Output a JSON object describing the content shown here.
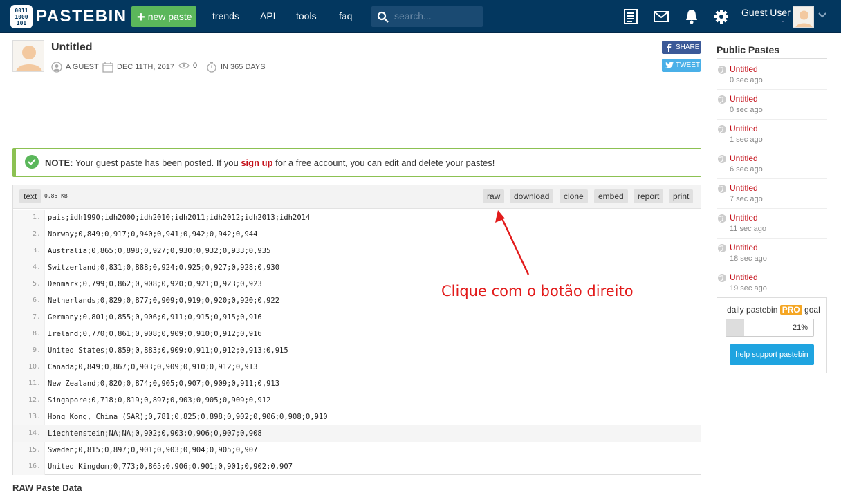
{
  "header": {
    "brand": "PASTEBIN",
    "new_paste": "new paste",
    "nav": [
      "trends",
      "API",
      "tools",
      "faq"
    ],
    "search_placeholder": "search...",
    "user_name": "Guest User",
    "user_sub": "-"
  },
  "paste": {
    "title": "Untitled",
    "author": "A GUEST",
    "date": "DEC 11TH, 2017",
    "views": "0",
    "expires": "IN 365 DAYS",
    "share": "SHARE",
    "tweet": "TWEET"
  },
  "note": {
    "label": "NOTE:",
    "text_before": " Your guest paste has been posted. If you ",
    "link": "sign up",
    "text_after": " for a free account, you can edit and delete your pastes!"
  },
  "code": {
    "syntax": "text",
    "size": "0.85 KB",
    "actions": [
      "raw",
      "download",
      "clone",
      "embed",
      "report",
      "print"
    ],
    "lines": [
      "pais;idh1990;idh2000;idh2010;idh2011;idh2012;idh2013;idh2014",
      "Norway;0,849;0,917;0,940;0,941;0,942;0,942;0,944",
      "Australia;0,865;0,898;0,927;0,930;0,932;0,933;0,935",
      "Switzerland;0,831;0,888;0,924;0,925;0,927;0,928;0,930",
      "Denmark;0,799;0,862;0,908;0,920;0,921;0,923;0,923",
      "Netherlands;0,829;0,877;0,909;0,919;0,920;0,920;0,922",
      "Germany;0,801;0,855;0,906;0,911;0,915;0,915;0,916",
      "Ireland;0,770;0,861;0,908;0,909;0,910;0,912;0,916",
      "United States;0,859;0,883;0,909;0,911;0,912;0,913;0,915",
      "Canada;0,849;0,867;0,903;0,909;0,910;0,912;0,913",
      "New Zealand;0,820;0,874;0,905;0,907;0,909;0,911;0,913",
      "Singapore;0,718;0,819;0,897;0,903;0,905;0,909;0,912",
      "Hong Kong, China (SAR);0,781;0,825;0,898;0,902;0,906;0,908;0,910",
      "Liechtenstein;NA;NA;0,902;0,903;0,906;0,907;0,908",
      "Sweden;0,815;0,897;0,901;0,903;0,904;0,905;0,907",
      "United Kingdom;0,773;0,865;0,906;0,901;0,901;0,902;0,907"
    ],
    "highlighted_line": 14
  },
  "annotation": "Clique com o botão direito",
  "sidebar": {
    "title": "Public Pastes",
    "items": [
      {
        "title": "Untitled",
        "time": "0 sec ago"
      },
      {
        "title": "Untitled",
        "time": "0 sec ago"
      },
      {
        "title": "Untitled",
        "time": "1 sec ago"
      },
      {
        "title": "Untitled",
        "time": "6 sec ago"
      },
      {
        "title": "Untitled",
        "time": "7 sec ago"
      },
      {
        "title": "Untitled",
        "time": "11 sec ago"
      },
      {
        "title": "Untitled",
        "time": "18 sec ago"
      },
      {
        "title": "Untitled",
        "time": "19 sec ago"
      }
    ],
    "pro": {
      "prefix": "daily pastebin ",
      "badge": "PRO",
      "suffix": " goal",
      "progress": 0.21,
      "progress_text": "21%",
      "button": "help support pastebin"
    }
  },
  "raw_label": "RAW Paste Data",
  "colors": {
    "header_bg": "#03375f",
    "accent_green": "#5bb75b",
    "link_red": "#c4101a",
    "annotation_red": "#e21b1b"
  }
}
